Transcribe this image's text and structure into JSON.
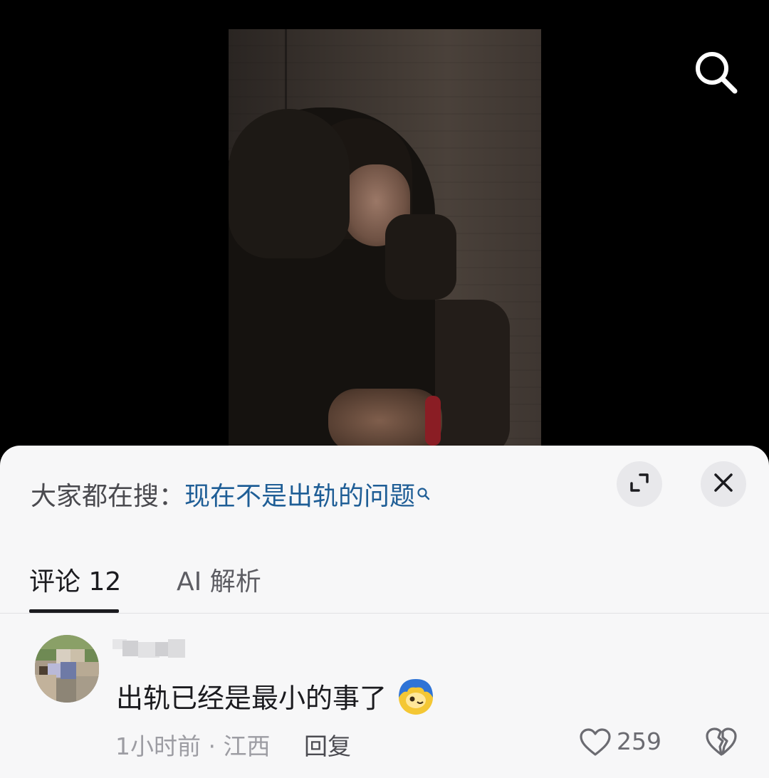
{
  "video": {
    "description_icon": "search-icon"
  },
  "sheet": {
    "trending_prefix": "大家都在搜：",
    "trending_query": "现在不是出轨的问题",
    "expand_icon": "expand-icon",
    "close_icon": "close-icon"
  },
  "tabs": [
    {
      "label": "评论 12",
      "active": true
    },
    {
      "label": "AI 解析",
      "active": false
    }
  ],
  "comment": {
    "text": "出轨已经是最小的事了",
    "time": "1小时前",
    "separator": " · ",
    "location": "江西",
    "reply_label": "回复",
    "like_count": "259"
  },
  "colors": {
    "link": "#1f5e96",
    "sheet_bg": "#f7f7f8",
    "round_button_bg": "#e8e8eb"
  }
}
